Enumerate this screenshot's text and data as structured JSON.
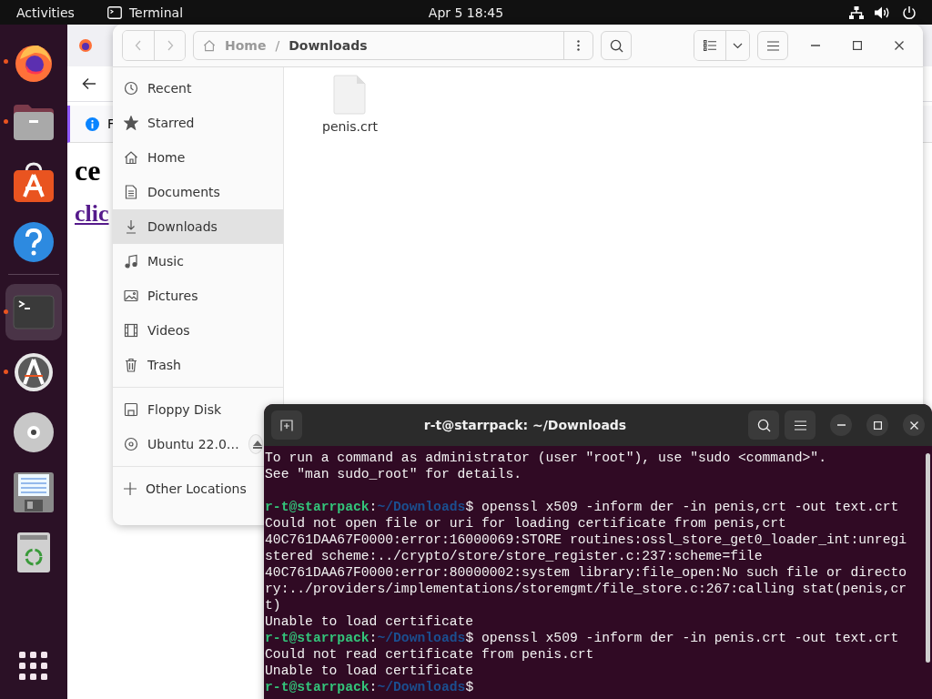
{
  "top_bar": {
    "activities": "Activities",
    "app_name": "Terminal",
    "clock": "Apr 5  18:45"
  },
  "dock": {
    "items": [
      {
        "kind": "firefox",
        "running": true,
        "selected": false
      },
      {
        "kind": "files",
        "running": true,
        "selected": false
      },
      {
        "kind": "software",
        "running": false,
        "selected": false
      },
      {
        "kind": "help",
        "running": false,
        "selected": false
      },
      {
        "kind": "terminal",
        "running": true,
        "selected": true
      },
      {
        "kind": "updater",
        "running": true,
        "selected": false
      },
      {
        "kind": "disc",
        "running": false,
        "selected": false
      },
      {
        "kind": "floppy",
        "running": false,
        "selected": false
      },
      {
        "kind": "trash",
        "running": false,
        "selected": false
      }
    ]
  },
  "browser": {
    "info": "F",
    "heading": "ce",
    "link": "clic"
  },
  "files": {
    "path": [
      {
        "label": "Home",
        "selected": false
      },
      {
        "label": "Downloads",
        "separator": "/",
        "selected": true
      }
    ],
    "sidebar": {
      "places": [
        {
          "kind": "recent",
          "label": "Recent",
          "selected": false
        },
        {
          "kind": "starred",
          "label": "Starred",
          "selected": false
        },
        {
          "kind": "home",
          "label": "Home",
          "selected": false
        },
        {
          "kind": "documents",
          "label": "Documents",
          "selected": false
        },
        {
          "kind": "downloads",
          "label": "Downloads",
          "selected": true
        },
        {
          "kind": "music",
          "label": "Music",
          "selected": false
        },
        {
          "kind": "pictures",
          "label": "Pictures",
          "selected": false
        },
        {
          "kind": "videos",
          "label": "Videos",
          "selected": false
        },
        {
          "kind": "trash",
          "label": "Trash",
          "selected": false
        }
      ],
      "devices": [
        {
          "kind": "floppy",
          "label": "Floppy Disk",
          "ejectable": false
        },
        {
          "kind": "disc",
          "label": "Ubuntu 22.0…",
          "ejectable": true
        }
      ],
      "other": "Other Locations"
    },
    "items": [
      {
        "name": "penis.crt"
      }
    ]
  },
  "terminal": {
    "title": "r-t@starrpack: ~/Downloads",
    "lines": [
      {
        "kind": "output",
        "text": "To run a command as administrator (user \"root\"), use \"sudo <command>\"."
      },
      {
        "kind": "output",
        "text": "See \"man sudo_root\" for details."
      },
      {
        "kind": "blank"
      },
      {
        "kind": "prompt",
        "user": "r-t@starrpack",
        "sep": ":",
        "path": "~/Downloads",
        "dollar": "$",
        "command": "openssl x509 -inform der -in penis,crt -out text.crt"
      },
      {
        "kind": "output",
        "text": "Could not open file or uri for loading certificate from penis,crt"
      },
      {
        "kind": "output",
        "text": "40C761DAA67F0000:error:16000069:STORE routines:ossl_store_get0_loader_int:unregi"
      },
      {
        "kind": "output",
        "text": "stered scheme:../crypto/store/store_register.c:237:scheme=file"
      },
      {
        "kind": "output",
        "text": "40C761DAA67F0000:error:80000002:system library:file_open:No such file or directo"
      },
      {
        "kind": "output",
        "text": "ry:../providers/implementations/storemgmt/file_store.c:267:calling stat(penis,cr"
      },
      {
        "kind": "output",
        "text": "t)"
      },
      {
        "kind": "output",
        "text": "Unable to load certificate"
      },
      {
        "kind": "prompt",
        "user": "r-t@starrpack",
        "sep": ":",
        "path": "~/Downloads",
        "dollar": "$",
        "command": "openssl x509 -inform der -in penis.crt -out text.crt"
      },
      {
        "kind": "output",
        "text": "Could not read certificate from penis.crt"
      },
      {
        "kind": "output",
        "text": "Unable to load certificate"
      },
      {
        "kind": "prompt",
        "user": "r-t@starrpack",
        "sep": ":",
        "path": "~/Downloads",
        "dollar": "$"
      }
    ]
  }
}
